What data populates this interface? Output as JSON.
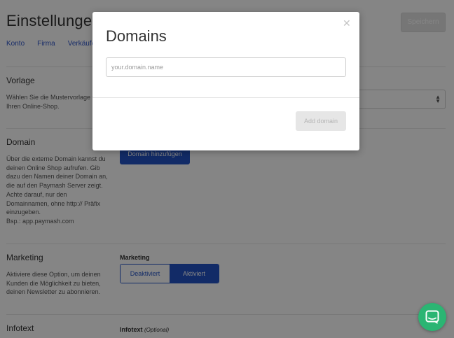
{
  "page": {
    "title": "Einstellungen",
    "save_label": "Speichern",
    "tabs": [
      "Konto",
      "Firma",
      "Verkäufer"
    ]
  },
  "sections": {
    "vorlage": {
      "title": "Vorlage",
      "description": "Wählen Sie die Mustervorlage für Ihren Online-Shop."
    },
    "domain": {
      "title": "Domain",
      "description": "Über die externe Domain kannst du deinen Online Shop aufrufen. Gib dazu den Namen deiner Domain an, die auf den Paymash Server zeigt. Achte darauf, nur den Domainnamen, ohne http:// Präfix einzugeben.",
      "example": "Bsp.: app.paymash.com",
      "add_button_label": "Domain hinzufügen"
    },
    "marketing": {
      "title": "Marketing",
      "description": "Aktiviere diese Option, um deinen Kunden die Möglichkeit zu bieten, deinen Newsletter zu abonnieren.",
      "field_label": "Marketing",
      "toggle_off": "Deaktiviert",
      "toggle_on": "Aktiviert",
      "selected": "Aktiviert"
    },
    "infotext": {
      "title": "Infotext",
      "field_label": "Infotext",
      "field_optional": "(Optional)"
    }
  },
  "modal": {
    "title": "Domains",
    "close_icon": "close-icon",
    "input_placeholder": "your.domain.name",
    "input_value": "",
    "add_button_label": "Add domain"
  },
  "chat": {
    "icon": "chat-icon",
    "color": "#2bb573"
  },
  "colors": {
    "accent": "#2454c6",
    "link": "#2f55c9"
  }
}
